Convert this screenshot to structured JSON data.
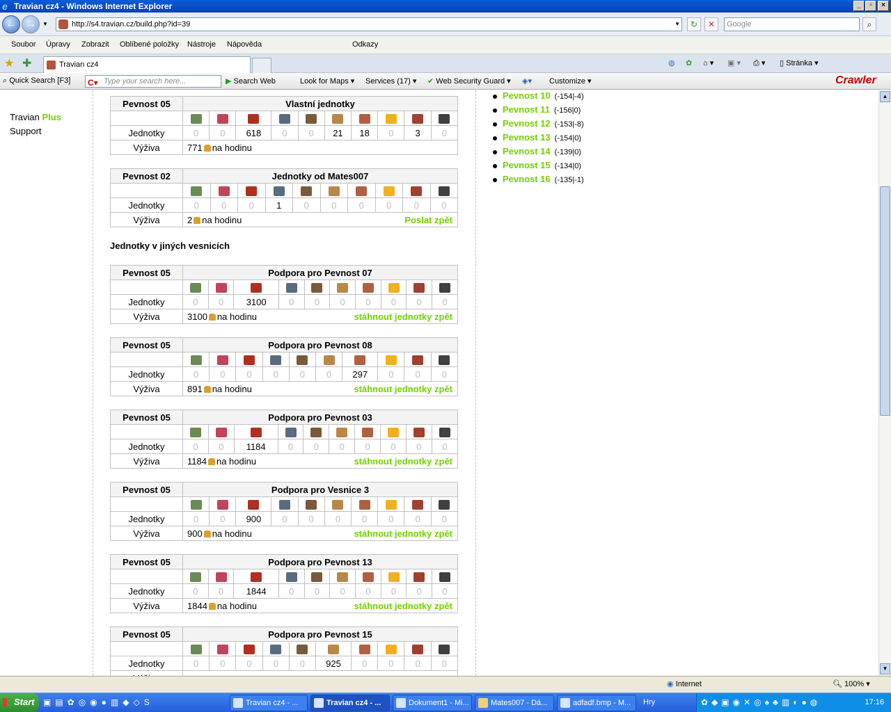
{
  "window": {
    "title": "Travian cz4 - Windows Internet Explorer"
  },
  "browser": {
    "url": "http://s4.travian.cz/build.php?id=39",
    "search_placeholder": "Google",
    "menu": [
      "Soubor",
      "Úpravy",
      "Zobrazit",
      "Oblíbené položky",
      "Nástroje",
      "Nápověda"
    ],
    "links_label": "Odkazy",
    "tab_title": "Travian cz4",
    "page_menu": "Stránka"
  },
  "crawler_toolbar": {
    "quick_search": "Quick Search [F3]",
    "search_placeholder": "Type your search here...",
    "search_web": "Search Web",
    "look_for_maps": "Look for Maps",
    "services": "Services (17)",
    "web_security": "Web Security Guard",
    "customize": "Customize",
    "logo": "Crawler"
  },
  "sidebar": {
    "travian": "Travian",
    "plus": "Plus",
    "support": "Support"
  },
  "villages": [
    {
      "name": "Pevnost 10",
      "coords": "(-154|-4)"
    },
    {
      "name": "Pevnost 11",
      "coords": "(-156|0)"
    },
    {
      "name": "Pevnost 12",
      "coords": "(-153|-8)"
    },
    {
      "name": "Pevnost 13",
      "coords": "(-154|0)"
    },
    {
      "name": "Pevnost 14",
      "coords": "(-139|0)"
    },
    {
      "name": "Pevnost 15",
      "coords": "(-134|0)"
    },
    {
      "name": "Pevnost 16",
      "coords": "(-135|-1)"
    }
  ],
  "labels": {
    "units": "Jednotky",
    "food": "Výživa",
    "per_hour": "na hodinu",
    "other_villages": "Jednotky v jiných vesnicích"
  },
  "unit_icon_colors": [
    "#6b8a55",
    "#c0445a",
    "#b03020",
    "#5a6a80",
    "#7a5a3a",
    "#b8884a",
    "#b06040",
    "#f0b020",
    "#a04030",
    "#404040"
  ],
  "tables": [
    {
      "village": "Pevnost 05",
      "title": "Vlastní jednotky",
      "units": [
        0,
        0,
        618,
        0,
        0,
        21,
        18,
        0,
        3,
        0
      ],
      "food": "771",
      "action": ""
    },
    {
      "village": "Pevnost 02",
      "title": "Jednotky od Mates007",
      "units": [
        0,
        0,
        0,
        1,
        0,
        0,
        0,
        0,
        0,
        0
      ],
      "food": "2",
      "action": "Poslat zpět"
    },
    {
      "village": "Pevnost 05",
      "title": "Podpora pro Pevnost 07",
      "units": [
        0,
        0,
        3100,
        0,
        0,
        0,
        0,
        0,
        0,
        0
      ],
      "food": "3100",
      "action": "stáhnout jednotky zpět"
    },
    {
      "village": "Pevnost 05",
      "title": "Podpora pro Pevnost 08",
      "units": [
        0,
        0,
        0,
        0,
        0,
        0,
        297,
        0,
        0,
        0
      ],
      "food": "891",
      "action": "stáhnout jednotky zpět"
    },
    {
      "village": "Pevnost 05",
      "title": "Podpora pro Pevnost 03",
      "units": [
        0,
        0,
        1184,
        0,
        0,
        0,
        0,
        0,
        0,
        0
      ],
      "food": "1184",
      "action": "stáhnout jednotky zpět"
    },
    {
      "village": "Pevnost 05",
      "title": "Podpora pro Vesnice 3",
      "units": [
        0,
        0,
        900,
        0,
        0,
        0,
        0,
        0,
        0,
        0
      ],
      "food": "900",
      "action": "stáhnout jednotky zpět"
    },
    {
      "village": "Pevnost 05",
      "title": "Podpora pro Pevnost 13",
      "units": [
        0,
        0,
        1844,
        0,
        0,
        0,
        0,
        0,
        0,
        0
      ],
      "food": "1844",
      "action": "stáhnout jednotky zpět"
    },
    {
      "village": "Pevnost 05",
      "title": "Podpora pro Pevnost 15",
      "units": [
        0,
        0,
        0,
        0,
        0,
        925,
        0,
        0,
        0,
        0
      ],
      "food": "",
      "action": ""
    }
  ],
  "status": {
    "zone": "Internet",
    "zoom": "100%"
  },
  "taskbar": {
    "start": "Start",
    "tasks": [
      "Travian cz4 - ...",
      "Travian cz4 - ...",
      "Dokument1 - Mi...",
      "Mates007 - Dá...",
      "adfadf.bmp - M..."
    ],
    "hry": "Hry",
    "clock": "17:16"
  }
}
